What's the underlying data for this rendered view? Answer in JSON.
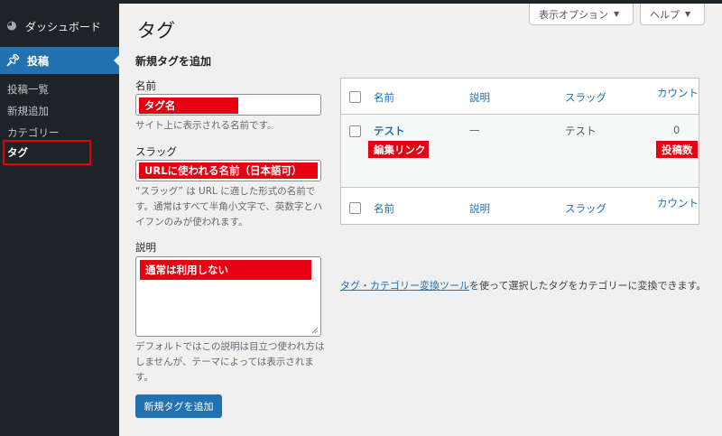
{
  "sidebar": {
    "dashboard_label": "ダッシュボード",
    "posts_label": "投稿",
    "sub_items": [
      "投稿一覧",
      "新規追加",
      "カテゴリー",
      "タグ"
    ]
  },
  "header": {
    "screen_options": "表示オプション",
    "help": "ヘルプ"
  },
  "page": {
    "title": "タグ"
  },
  "form": {
    "section_title": "新規タグを追加",
    "name_label": "名前",
    "name_desc": "サイト上に表示される名前です。",
    "slug_label": "スラッグ",
    "slug_desc": "“スラッグ” は URL に適した形式の名前です。通常はすべて半角小文字で、英数字とハイフンのみが使われます。",
    "description_label": "説明",
    "description_desc": "デフォルトではこの説明は目立つ使われ方はしませんが、テーマによっては表示されます。",
    "submit_label": "新規タグを追加"
  },
  "annotations": {
    "name": "タグ名",
    "slug": "URLに使われる名前（日本語可）",
    "description": "通常は利用しない",
    "edit_link": "編集リンク",
    "post_count": "投稿数"
  },
  "table": {
    "columns": [
      "名前",
      "説明",
      "スラッグ",
      "カウント"
    ],
    "rows": [
      {
        "name": "テスト",
        "description": "—",
        "slug": "テスト",
        "count": "0"
      }
    ]
  },
  "footer": {
    "tool_link": "タグ・カテゴリー変換ツール",
    "tool_text": "を使って選択したタグをカテゴリーに変換できます。"
  },
  "colors": {
    "sidebar_bg": "#1d2327",
    "accent": "#2271b1",
    "annotation_red": "#e60012"
  }
}
